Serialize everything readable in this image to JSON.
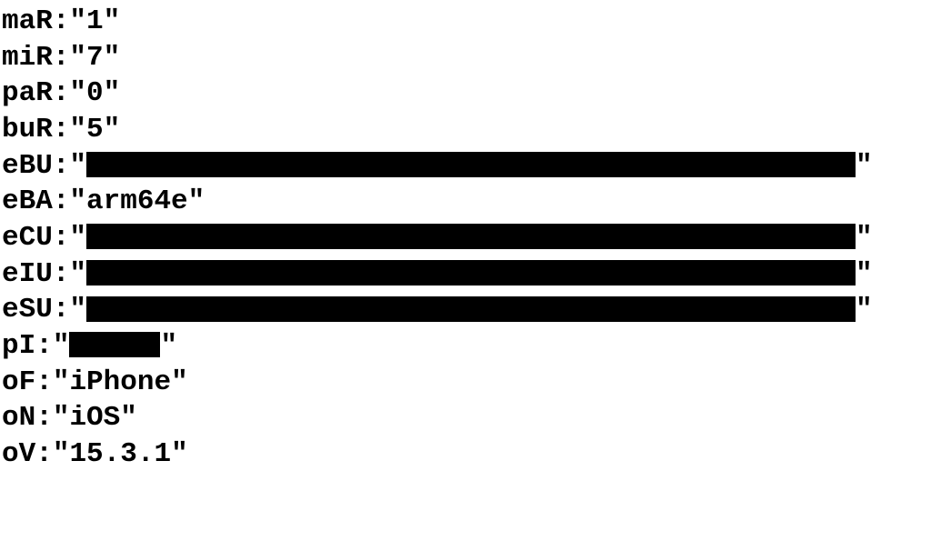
{
  "rows": [
    {
      "key": "maR",
      "value": "1",
      "redacted": false
    },
    {
      "key": "miR",
      "value": "7",
      "redacted": false
    },
    {
      "key": "paR",
      "value": "0",
      "redacted": false
    },
    {
      "key": "buR",
      "value": "5",
      "redacted": false
    },
    {
      "key": "eBU",
      "value": "",
      "redacted": true,
      "redactClass": "redact-long"
    },
    {
      "key": "eBA",
      "value": "arm64e",
      "redacted": false
    },
    {
      "key": "eCU",
      "value": "",
      "redacted": true,
      "redactClass": "redact-long"
    },
    {
      "key": "eIU",
      "value": "",
      "redacted": true,
      "redactClass": "redact-long"
    },
    {
      "key": "eSU",
      "value": "",
      "redacted": true,
      "redactClass": "redact-long"
    },
    {
      "key": "pI",
      "value": "",
      "redacted": true,
      "redactClass": "redact-short"
    },
    {
      "key": "oF",
      "value": "iPhone",
      "redacted": false
    },
    {
      "key": "oN",
      "value": "iOS",
      "redacted": false
    },
    {
      "key": "oV",
      "value": "15.3.1",
      "redacted": false
    }
  ]
}
